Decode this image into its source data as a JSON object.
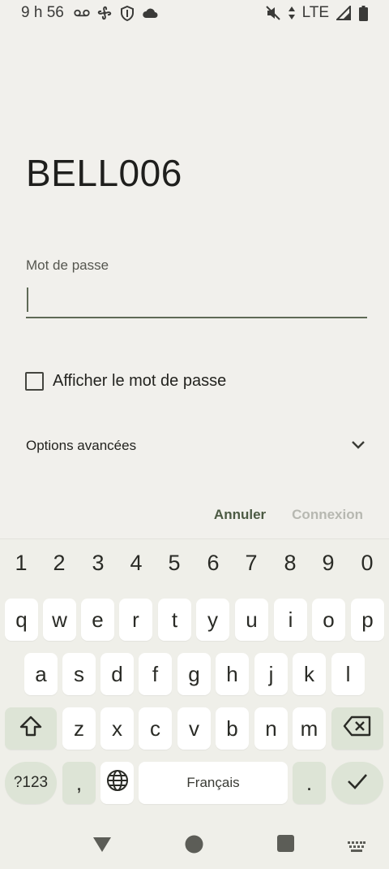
{
  "status_bar": {
    "time": "9 h 56",
    "network": "LTE",
    "left_icons": [
      "voicemail-icon",
      "fan-icon",
      "shield-icon",
      "cloud-icon"
    ],
    "right_icons": [
      "mute-icon",
      "data-arrows-icon",
      "signal-icon",
      "battery-icon"
    ]
  },
  "dialog": {
    "title": "BELL006",
    "password_label": "Mot de passe",
    "password_value": "",
    "show_password_label": "Afficher le mot de passe",
    "show_password_checked": false,
    "advanced_label": "Options avancées",
    "cancel_label": "Annuler",
    "connect_label": "Connexion"
  },
  "keyboard": {
    "numbers": [
      "1",
      "2",
      "3",
      "4",
      "5",
      "6",
      "7",
      "8",
      "9",
      "0"
    ],
    "row1": [
      "q",
      "w",
      "e",
      "r",
      "t",
      "y",
      "u",
      "i",
      "o",
      "p"
    ],
    "row2": [
      "a",
      "s",
      "d",
      "f",
      "g",
      "h",
      "j",
      "k",
      "l"
    ],
    "row3": [
      "z",
      "x",
      "c",
      "v",
      "b",
      "n",
      "m"
    ],
    "sym_label": "?123",
    "comma_label": ",",
    "space_label": "Français",
    "period_label": "."
  },
  "colors": {
    "background": "#f1f0ec",
    "accent": "#5e6a56",
    "modifier_key": "#dde4d6"
  }
}
